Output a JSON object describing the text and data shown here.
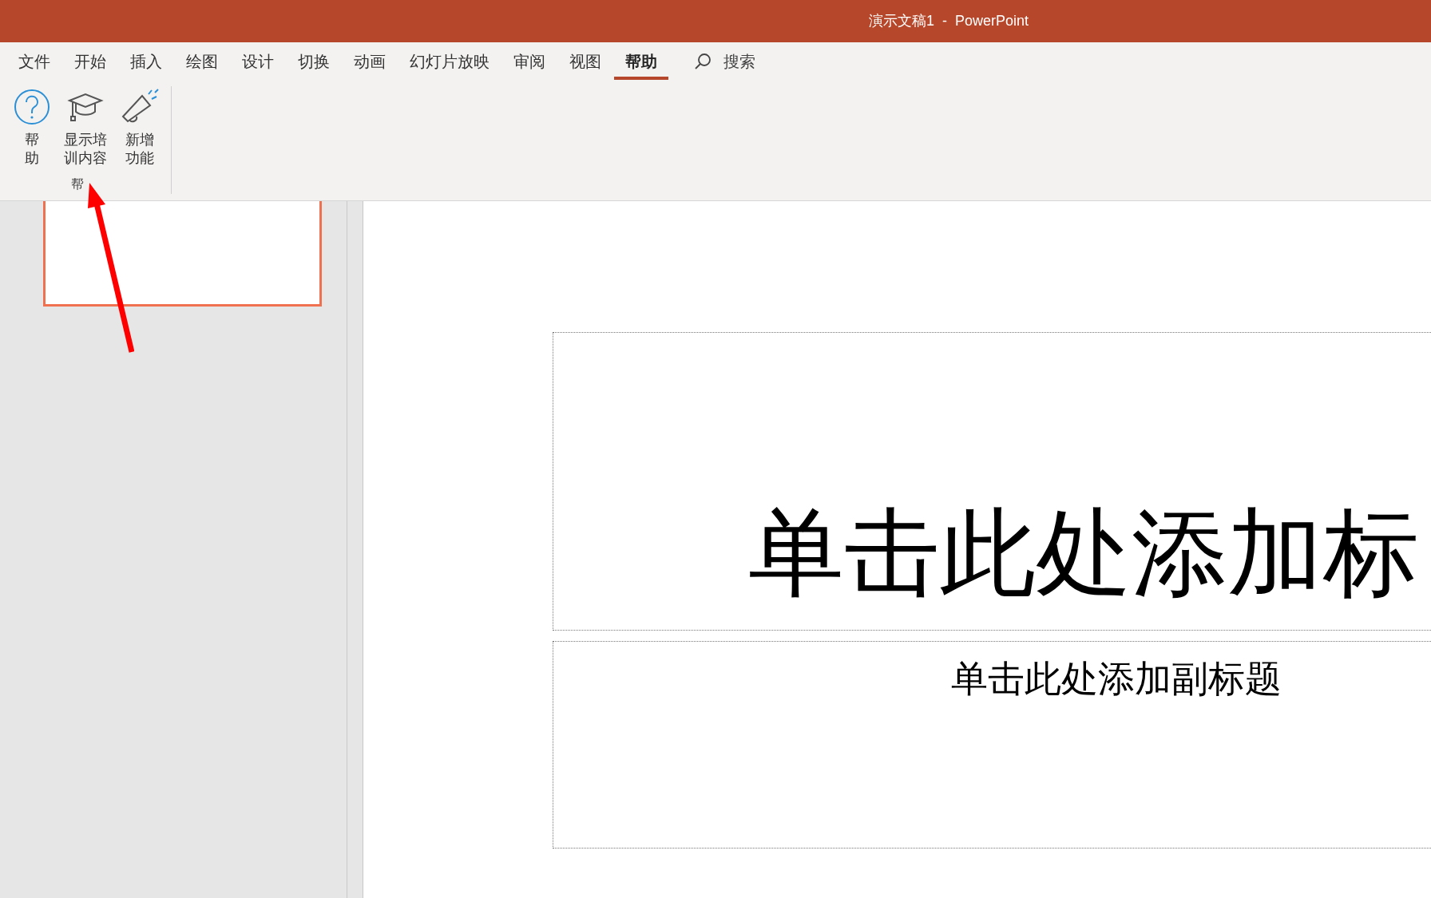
{
  "window": {
    "title": "演示文稿1  -  PowerPoint"
  },
  "tabs": [
    {
      "label": "文件",
      "selected": false
    },
    {
      "label": "开始",
      "selected": false
    },
    {
      "label": "插入",
      "selected": false
    },
    {
      "label": "绘图",
      "selected": false
    },
    {
      "label": "设计",
      "selected": false
    },
    {
      "label": "切换",
      "selected": false
    },
    {
      "label": "动画",
      "selected": false
    },
    {
      "label": "幻灯片放映",
      "selected": false
    },
    {
      "label": "审阅",
      "selected": false
    },
    {
      "label": "视图",
      "selected": false
    },
    {
      "label": "帮助",
      "selected": true
    }
  ],
  "search": {
    "label": "搜索"
  },
  "ribbon": {
    "groups": [
      {
        "label": "帮",
        "buttons": [
          {
            "kind": "help",
            "lines": [
              "帮",
              "助"
            ]
          },
          {
            "kind": "training",
            "lines": [
              "显示培",
              "训内容"
            ]
          },
          {
            "kind": "whatsnew",
            "lines": [
              "新增",
              "功能"
            ]
          }
        ]
      }
    ]
  },
  "slide": {
    "title_placeholder": "单击此处添加标",
    "subtitle_placeholder": "单击此处添加副标题"
  }
}
